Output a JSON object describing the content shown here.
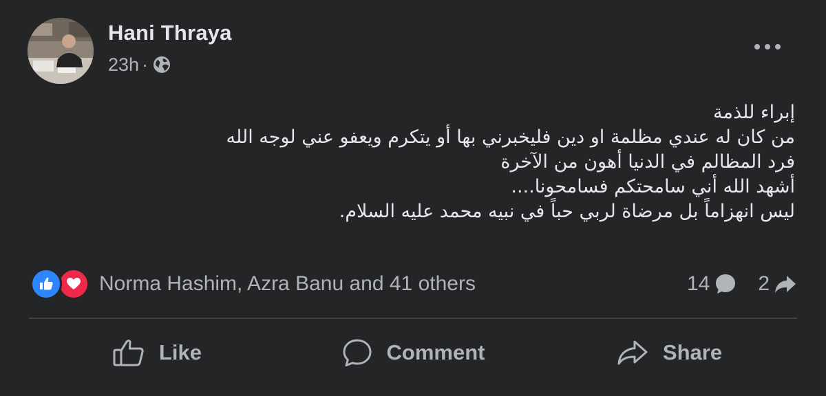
{
  "post": {
    "author": "Hani Thraya",
    "timestamp": "23h",
    "separator": "·",
    "privacy_icon": "globe-icon",
    "menu_icon": "more-horizontal-icon",
    "body_lines": [
      "إبراء للذمة",
      "من كان له عندي مظلمة او دين فليخبرني بها أو يتكرم ويعفو عني لوجه الله",
      "فرد المظالم في الدنيا أهون من الآخرة",
      "أشهد الله أني سامحتكم فسامحونا....",
      "ليس انهزاماً بل مرضاة لربي حباً في نبيه محمد عليه السلام."
    ]
  },
  "reactions": {
    "icons": [
      "like-reaction-icon",
      "love-reaction-icon"
    ],
    "summary": "Norma Hashim, Azra Banu and 41 others",
    "comment_count": "14",
    "share_count": "2"
  },
  "actions": {
    "like_label": "Like",
    "comment_label": "Comment",
    "share_label": "Share"
  },
  "colors": {
    "background": "#242526",
    "primary_text": "#e4e6eb",
    "secondary_text": "#b0b3b8",
    "like_blue": "#2d86ff",
    "love_red": "#f0284a",
    "divider": "#3e4042"
  }
}
